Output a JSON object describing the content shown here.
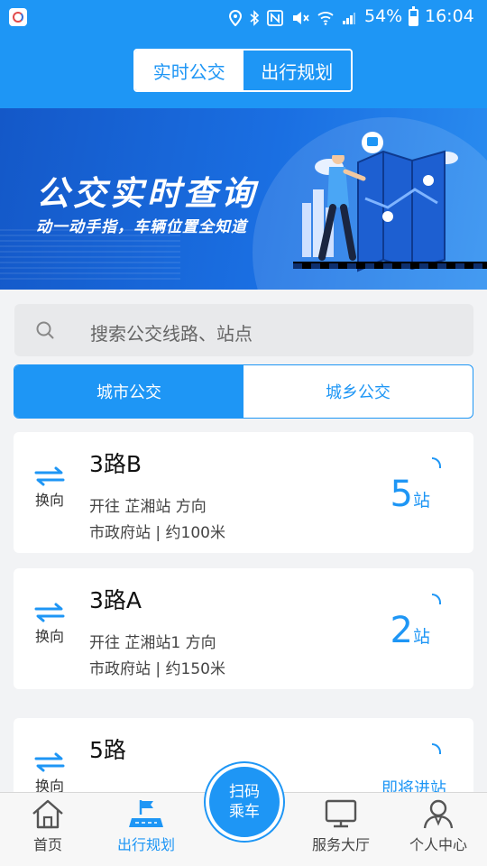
{
  "statusbar": {
    "battery_pct": "54%",
    "time": "16:04"
  },
  "header": {
    "tabs": [
      {
        "label": "实时公交",
        "active": true
      },
      {
        "label": "出行规划",
        "active": false
      }
    ]
  },
  "banner": {
    "title": "公交实时查询",
    "subtitle": "动一动手指，车辆位置全知道"
  },
  "search": {
    "placeholder": "搜索公交线路、站点"
  },
  "type_tabs": [
    {
      "label": "城市公交",
      "active": true
    },
    {
      "label": "城乡公交",
      "active": false
    }
  ],
  "routes": [
    {
      "direction_label": "换向",
      "route": "3路B",
      "heading": "开往 芷湘站 方向",
      "stop_info": "市政府站 | 约100米",
      "stops_count": "5",
      "stops_unit": "站"
    },
    {
      "direction_label": "换向",
      "route": "3路A",
      "heading": "开往 芷湘站1 方向",
      "stop_info": "市政府站 | 约150米",
      "stops_count": "2",
      "stops_unit": "站"
    },
    {
      "direction_label": "换向",
      "route": "5路",
      "status": "即将进站"
    }
  ],
  "bottom_nav": {
    "items": [
      {
        "label": "首页",
        "icon": "home-icon"
      },
      {
        "label": "出行规划",
        "icon": "flag-map-icon",
        "active": true
      },
      {
        "label": "服务大厅",
        "icon": "monitor-icon"
      },
      {
        "label": "个人中心",
        "icon": "user-icon"
      }
    ],
    "scan": {
      "line1": "扫码",
      "line2": "乘车"
    }
  },
  "colors": {
    "primary": "#1e96f5",
    "background": "#f2f3f5"
  }
}
